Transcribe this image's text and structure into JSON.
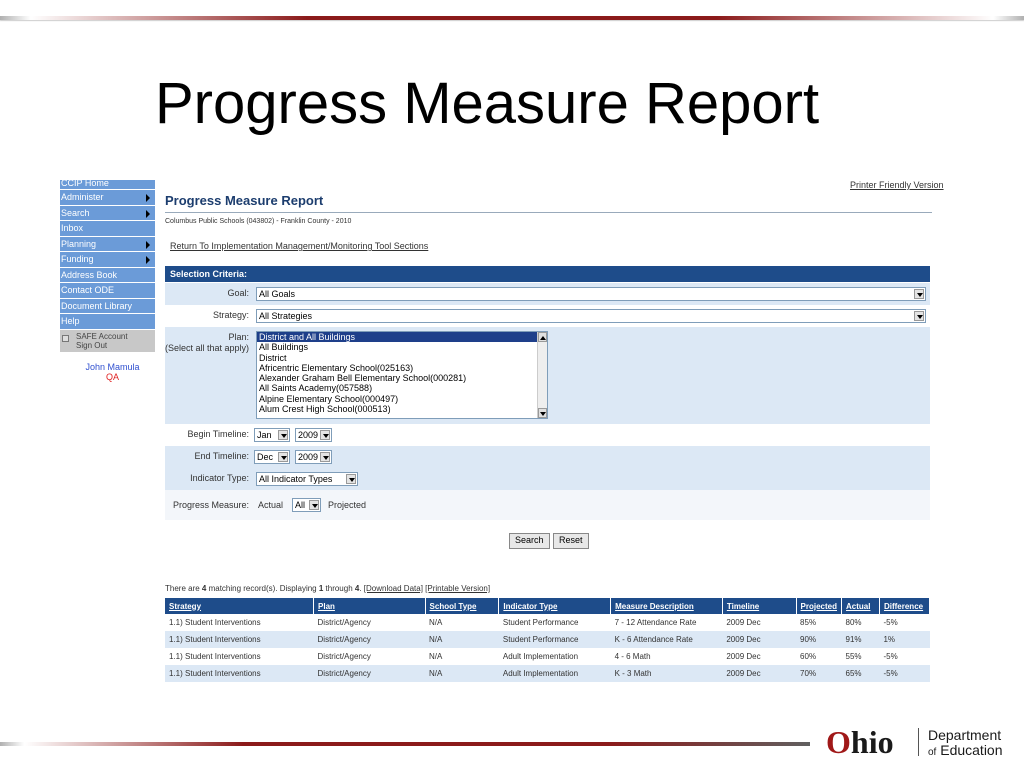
{
  "slide": {
    "title": "Progress Measure Report"
  },
  "nav": {
    "items": [
      {
        "label": "CCIP Home",
        "arrow": false
      },
      {
        "label": "Administer",
        "arrow": true
      },
      {
        "label": "Search",
        "arrow": true
      },
      {
        "label": "Inbox",
        "arrow": false
      },
      {
        "label": "Planning",
        "arrow": true
      },
      {
        "label": "Funding",
        "arrow": true
      },
      {
        "label": "Address Book",
        "arrow": false
      },
      {
        "label": "Contact ODE",
        "arrow": false
      },
      {
        "label": "Document Library",
        "arrow": false
      },
      {
        "label": "Help",
        "arrow": false
      }
    ],
    "safe_account": "SAFE Account",
    "sign_out": "Sign Out",
    "user_name": "John Mamula",
    "user_role": "QA"
  },
  "header": {
    "printer_friendly": "Printer Friendly Version",
    "page_title": "Progress Measure Report",
    "sub_info": "Columbus Public Schools (043802) - Franklin County - 2010",
    "return_link": "Return To Implementation Management/Monitoring Tool Sections"
  },
  "criteria": {
    "header": "Selection Criteria:",
    "goal_label": "Goal:",
    "goal_value": "All Goals",
    "strategy_label": "Strategy:",
    "strategy_value": "All Strategies",
    "plan_label": "Plan:",
    "plan_hint": "(Select all that apply)",
    "plan_options": [
      "District and All Buildings",
      "All Buildings",
      "District",
      "Africentric Elementary School(025163)",
      "Alexander Graham Bell Elementary School(000281)",
      "All Saints Academy(057588)",
      "Alpine Elementary School(000497)",
      "Alum Crest High School(000513)"
    ],
    "begin_label": "Begin Timeline:",
    "begin_month": "Jan",
    "begin_year": "2009",
    "end_label": "End Timeline:",
    "end_month": "Dec",
    "end_year": "2009",
    "indicator_label": "Indicator Type:",
    "indicator_value": "All Indicator Types",
    "progress_label": "Progress Measure:",
    "actual_label": "Actual",
    "progress_value": "All",
    "projected_label": "Projected",
    "search_button": "Search",
    "reset_button": "Reset"
  },
  "results": {
    "summary_prefix": "There are ",
    "count": "4",
    "summary_mid": " matching record(s). Displaying ",
    "from": "1",
    "through_text": " through ",
    "to": "4",
    "period": ". ",
    "download": "[Download Data]",
    "printable": "[Printable Version]",
    "columns": [
      "Strategy",
      "Plan",
      "School Type",
      "Indicator Type",
      "Measure Description",
      "Timeline",
      "Projected",
      "Actual",
      "Difference"
    ],
    "rows": [
      [
        "1.1) Student Interventions",
        "District/Agency",
        "N/A",
        "Student Performance",
        "7 - 12 Attendance Rate",
        "2009 Dec",
        "85%",
        "80%",
        "-5%"
      ],
      [
        "1.1) Student Interventions",
        "District/Agency",
        "N/A",
        "Student Performance",
        "K - 6 Attendance Rate",
        "2009 Dec",
        "90%",
        "91%",
        "1%"
      ],
      [
        "1.1) Student Interventions",
        "District/Agency",
        "N/A",
        "Adult Implementation",
        "4 - 6 Math",
        "2009 Dec",
        "60%",
        "55%",
        "-5%"
      ],
      [
        "1.1) Student Interventions",
        "District/Agency",
        "N/A",
        "Adult Implementation",
        "K - 3 Math",
        "2009 Dec",
        "70%",
        "65%",
        "-5%"
      ]
    ]
  },
  "logo": {
    "o": "O",
    "hio": "hio",
    "dept_line1": "Department",
    "dept_of": "of",
    "dept_line2": "Education"
  },
  "colors": {
    "nav_blue": "#6b9bd8",
    "header_blue": "#1e4c8a",
    "row_shade": "#dce8f5",
    "accent_red": "#8b1a1a"
  }
}
